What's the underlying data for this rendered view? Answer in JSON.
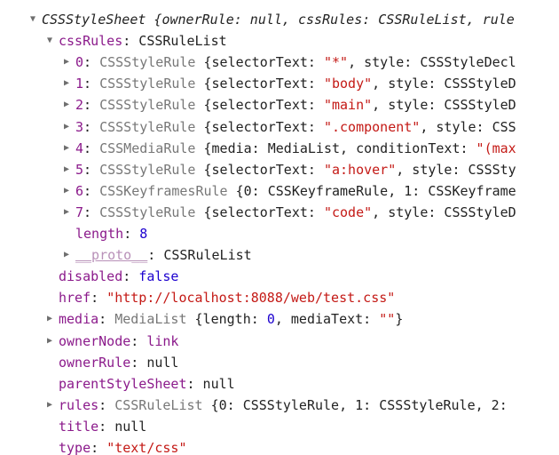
{
  "rows": [
    {
      "indent": 0,
      "toggle": "expanded",
      "segments": [
        {
          "c": "sum",
          "t": "CSSStyleSheet {ownerRule: null, cssRules: CSSRuleList, rule"
        }
      ]
    },
    {
      "indent": 1,
      "toggle": "expanded",
      "segments": [
        {
          "c": "k",
          "t": "cssRules"
        },
        {
          "c": "p",
          "t": ": CSSRuleList"
        }
      ]
    },
    {
      "indent": 2,
      "toggle": "collapsed",
      "segments": [
        {
          "c": "k",
          "t": "0"
        },
        {
          "c": "p",
          "t": ": "
        },
        {
          "c": "t",
          "t": "CSSStyleRule "
        },
        {
          "c": "p",
          "t": "{selectorText: "
        },
        {
          "c": "s",
          "t": "\"*\""
        },
        {
          "c": "p",
          "t": ", style: CSSStyleDecl"
        }
      ]
    },
    {
      "indent": 2,
      "toggle": "collapsed",
      "segments": [
        {
          "c": "k",
          "t": "1"
        },
        {
          "c": "p",
          "t": ": "
        },
        {
          "c": "t",
          "t": "CSSStyleRule "
        },
        {
          "c": "p",
          "t": "{selectorText: "
        },
        {
          "c": "s",
          "t": "\"body\""
        },
        {
          "c": "p",
          "t": ", style: CSSStyleD"
        }
      ]
    },
    {
      "indent": 2,
      "toggle": "collapsed",
      "segments": [
        {
          "c": "k",
          "t": "2"
        },
        {
          "c": "p",
          "t": ": "
        },
        {
          "c": "t",
          "t": "CSSStyleRule "
        },
        {
          "c": "p",
          "t": "{selectorText: "
        },
        {
          "c": "s",
          "t": "\"main\""
        },
        {
          "c": "p",
          "t": ", style: CSSStyleD"
        }
      ]
    },
    {
      "indent": 2,
      "toggle": "collapsed",
      "segments": [
        {
          "c": "k",
          "t": "3"
        },
        {
          "c": "p",
          "t": ": "
        },
        {
          "c": "t",
          "t": "CSSStyleRule "
        },
        {
          "c": "p",
          "t": "{selectorText: "
        },
        {
          "c": "s",
          "t": "\".component\""
        },
        {
          "c": "p",
          "t": ", style: CSS"
        }
      ]
    },
    {
      "indent": 2,
      "toggle": "collapsed",
      "segments": [
        {
          "c": "k",
          "t": "4"
        },
        {
          "c": "p",
          "t": ": "
        },
        {
          "c": "t",
          "t": "CSSMediaRule "
        },
        {
          "c": "p",
          "t": "{media: MediaList, conditionText: "
        },
        {
          "c": "s",
          "t": "\"(max"
        }
      ]
    },
    {
      "indent": 2,
      "toggle": "collapsed",
      "segments": [
        {
          "c": "k",
          "t": "5"
        },
        {
          "c": "p",
          "t": ": "
        },
        {
          "c": "t",
          "t": "CSSStyleRule "
        },
        {
          "c": "p",
          "t": "{selectorText: "
        },
        {
          "c": "s",
          "t": "\"a:hover\""
        },
        {
          "c": "p",
          "t": ", style: CSSSty"
        }
      ]
    },
    {
      "indent": 2,
      "toggle": "collapsed",
      "segments": [
        {
          "c": "k",
          "t": "6"
        },
        {
          "c": "p",
          "t": ": "
        },
        {
          "c": "t",
          "t": "CSSKeyframesRule "
        },
        {
          "c": "p",
          "t": "{0: CSSKeyframeRule, 1: CSSKeyframe"
        }
      ]
    },
    {
      "indent": 2,
      "toggle": "collapsed",
      "segments": [
        {
          "c": "k",
          "t": "7"
        },
        {
          "c": "p",
          "t": ": "
        },
        {
          "c": "t",
          "t": "CSSStyleRule "
        },
        {
          "c": "p",
          "t": "{selectorText: "
        },
        {
          "c": "s",
          "t": "\"code\""
        },
        {
          "c": "p",
          "t": ", style: CSSStyleD"
        }
      ]
    },
    {
      "indent": 2,
      "toggle": "none",
      "segments": [
        {
          "c": "k",
          "t": "length"
        },
        {
          "c": "p",
          "t": ": "
        },
        {
          "c": "n",
          "t": "8"
        }
      ]
    },
    {
      "indent": 2,
      "toggle": "collapsed",
      "segments": [
        {
          "c": "kp ul",
          "t": "__proto__"
        },
        {
          "c": "p",
          "t": ": CSSRuleList"
        }
      ]
    },
    {
      "indent": 1,
      "toggle": "none",
      "segments": [
        {
          "c": "k",
          "t": "disabled"
        },
        {
          "c": "p",
          "t": ": "
        },
        {
          "c": "n",
          "t": "false"
        }
      ]
    },
    {
      "indent": 1,
      "toggle": "none",
      "segments": [
        {
          "c": "k",
          "t": "href"
        },
        {
          "c": "p",
          "t": ": "
        },
        {
          "c": "s",
          "t": "\"http://localhost:8088/web/test.css\""
        }
      ]
    },
    {
      "indent": 1,
      "toggle": "collapsed",
      "segments": [
        {
          "c": "k",
          "t": "media"
        },
        {
          "c": "p",
          "t": ": "
        },
        {
          "c": "t",
          "t": "MediaList "
        },
        {
          "c": "p",
          "t": "{length: "
        },
        {
          "c": "n",
          "t": "0"
        },
        {
          "c": "p",
          "t": ", mediaText: "
        },
        {
          "c": "s",
          "t": "\"\""
        },
        {
          "c": "p",
          "t": "}"
        }
      ]
    },
    {
      "indent": 1,
      "toggle": "collapsed",
      "segments": [
        {
          "c": "k",
          "t": "ownerNode"
        },
        {
          "c": "p",
          "t": ": "
        },
        {
          "c": "k",
          "t": "link"
        }
      ]
    },
    {
      "indent": 1,
      "toggle": "none",
      "segments": [
        {
          "c": "k",
          "t": "ownerRule"
        },
        {
          "c": "p",
          "t": ": null"
        }
      ]
    },
    {
      "indent": 1,
      "toggle": "none",
      "segments": [
        {
          "c": "k",
          "t": "parentStyleSheet"
        },
        {
          "c": "p",
          "t": ": null"
        }
      ]
    },
    {
      "indent": 1,
      "toggle": "collapsed",
      "segments": [
        {
          "c": "k",
          "t": "rules"
        },
        {
          "c": "p",
          "t": ": "
        },
        {
          "c": "t",
          "t": "CSSRuleList "
        },
        {
          "c": "p",
          "t": "{0: CSSStyleRule, 1: CSSStyleRule, 2:"
        }
      ]
    },
    {
      "indent": 1,
      "toggle": "none",
      "segments": [
        {
          "c": "k",
          "t": "title"
        },
        {
          "c": "p",
          "t": ": null"
        }
      ]
    },
    {
      "indent": 1,
      "toggle": "none",
      "segments": [
        {
          "c": "k",
          "t": "type"
        },
        {
          "c": "p",
          "t": ": "
        },
        {
          "c": "s",
          "t": "\"text/css\""
        }
      ]
    }
  ],
  "icons": {
    "expanded": "chevron-down-icon",
    "collapsed": "chevron-right-icon"
  },
  "colors": {
    "key": "#8b1a8b",
    "key_prototype": "#b890b8",
    "type_name": "#777777",
    "number_boolean": "#1c00cf",
    "string": "#c41a16",
    "plain": "#222222",
    "toggle": "#6e6e6e"
  }
}
